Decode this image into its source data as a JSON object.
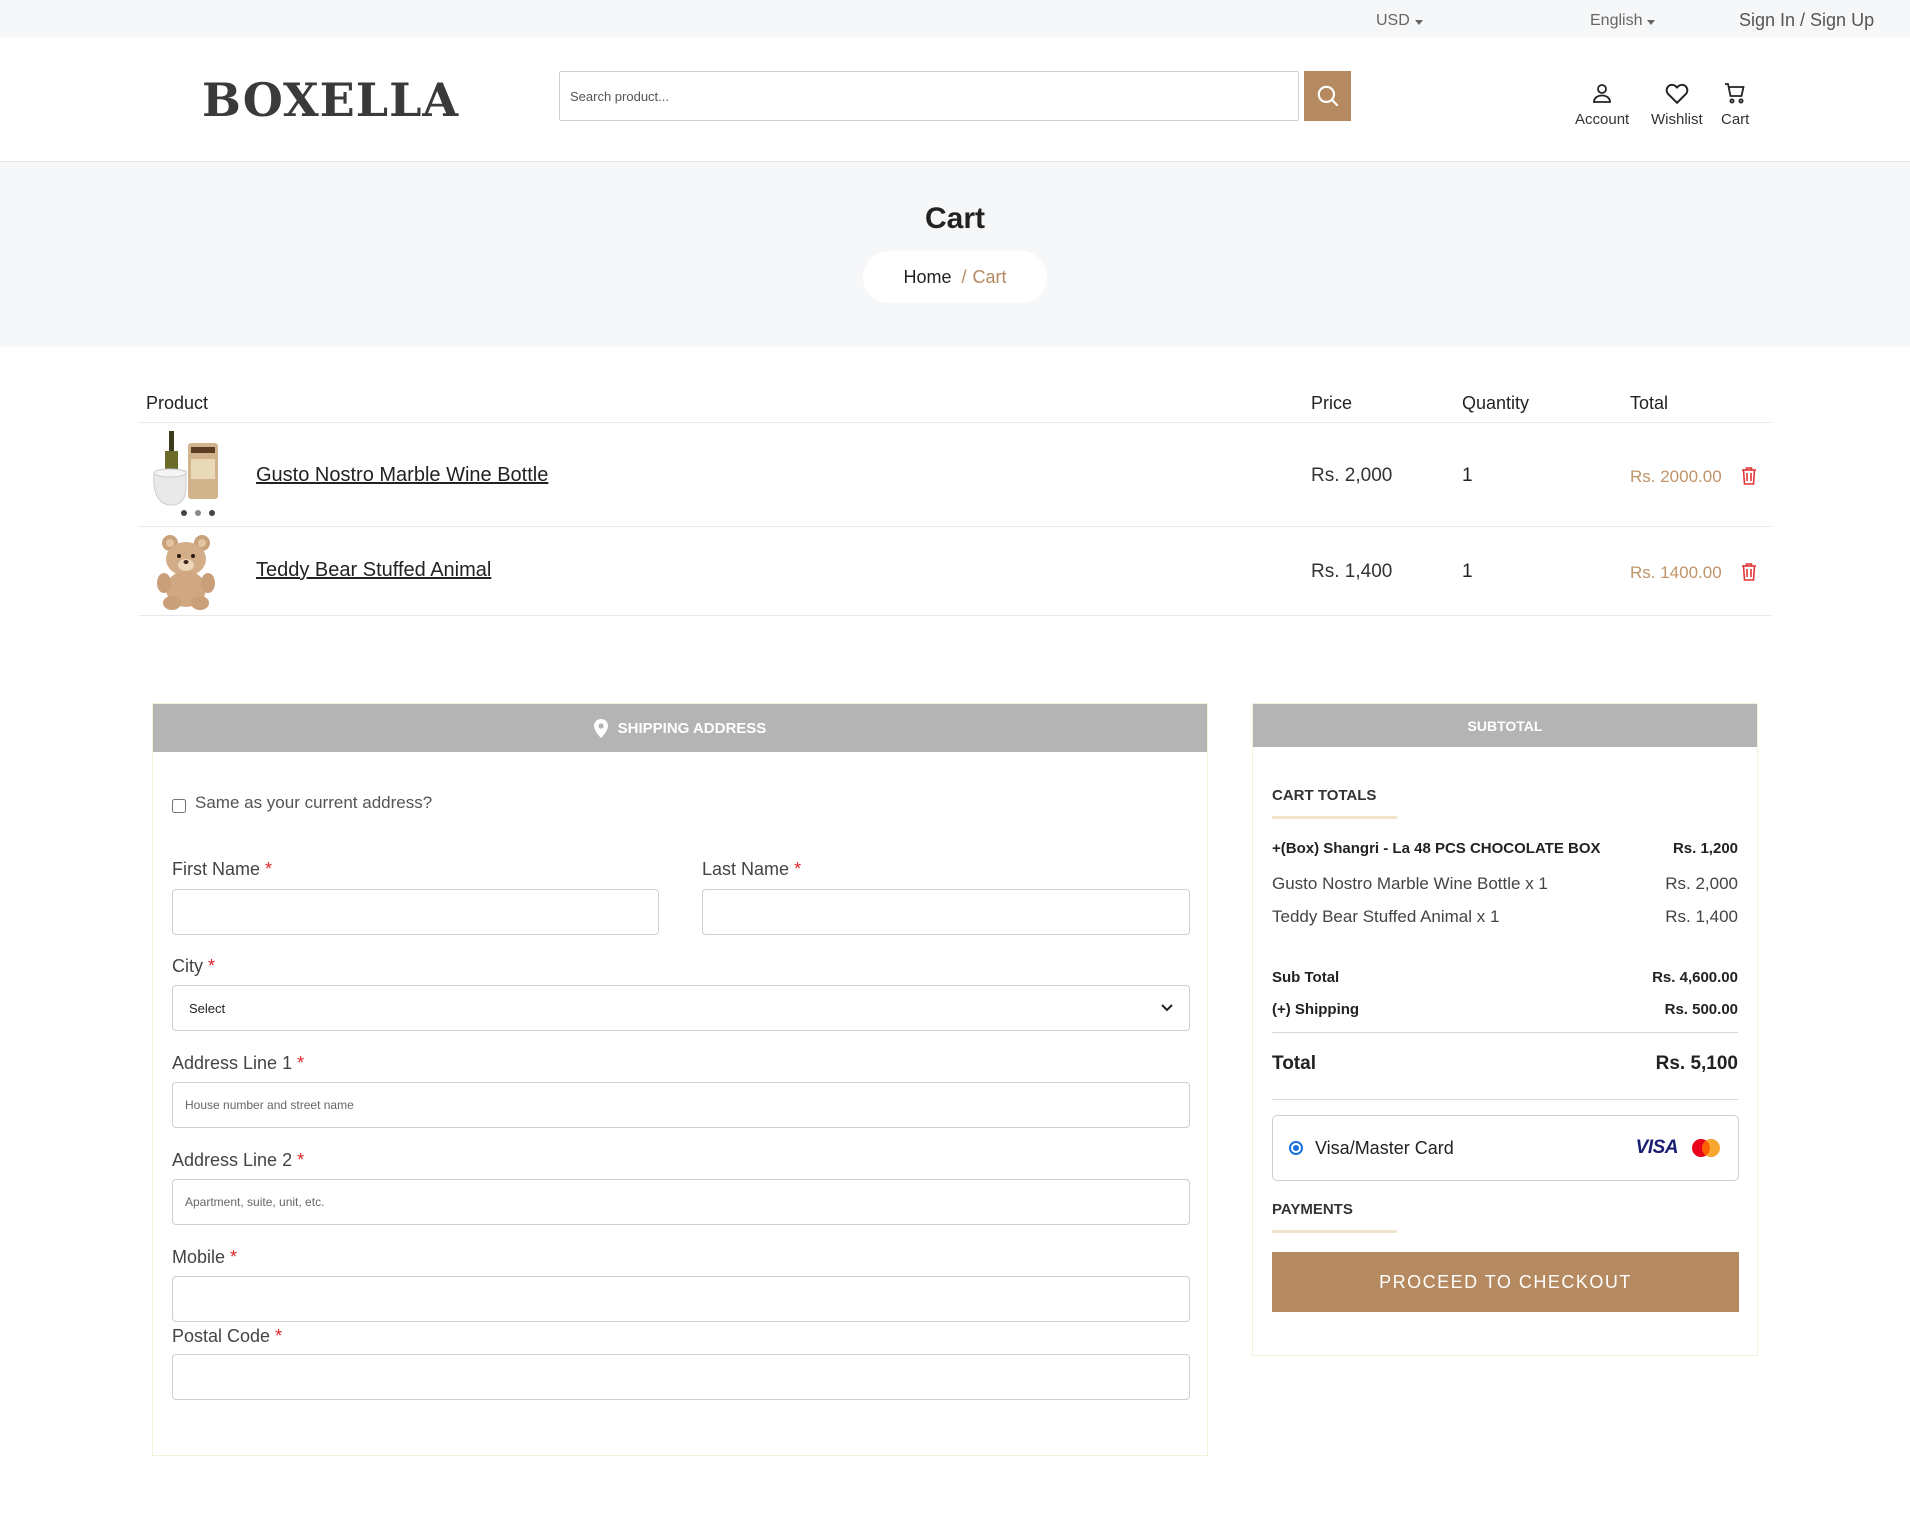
{
  "topbar": {
    "currency": "USD",
    "language": "English",
    "auth": "Sign In / Sign Up"
  },
  "header": {
    "logo": "BOXELLA",
    "search_placeholder": "Search product...",
    "actions": {
      "account": "Account",
      "wishlist": "Wishlist",
      "cart": "Cart"
    }
  },
  "hero": {
    "title": "Cart",
    "breadcrumb": {
      "home": "Home",
      "separator": "/",
      "current": "Cart"
    }
  },
  "cart_table": {
    "columns": {
      "product": "Product",
      "price": "Price",
      "quantity": "Quantity",
      "total": "Total"
    },
    "rows": [
      {
        "name": "Gusto Nostro Marble Wine Bottle",
        "price": "Rs. 2,000",
        "quantity": "1",
        "total": "Rs. 2000.00",
        "image": "wine-bottle-chiller-image"
      },
      {
        "name": "Teddy Bear Stuffed Animal",
        "price": "Rs. 1,400",
        "quantity": "1",
        "total": "Rs. 1400.00",
        "image": "teddy-bear-image"
      }
    ]
  },
  "shipping": {
    "header": "SHIPPING ADDRESS",
    "same_address_label": "Same as your current address?",
    "fields": {
      "first_name": {
        "label": "First Name",
        "value": ""
      },
      "last_name": {
        "label": "Last Name",
        "value": ""
      },
      "city": {
        "label": "City",
        "selected": "Select"
      },
      "address1": {
        "label": "Address Line 1",
        "placeholder": "House number and street name"
      },
      "address2": {
        "label": "Address Line 2",
        "placeholder": "Apartment, suite, unit, etc."
      },
      "mobile": {
        "label": "Mobile",
        "value": ""
      },
      "postal": {
        "label": "Postal Code",
        "value": ""
      }
    },
    "required_mark": "*"
  },
  "subtotal": {
    "header": "SUBTOTAL",
    "cart_totals_title": "CART TOTALS",
    "box_item": {
      "label": "+(Box) Shangri - La 48 PCS CHOCOLATE BOX",
      "amount": "Rs. 1,200"
    },
    "items": [
      {
        "label": "Gusto Nostro Marble Wine Bottle x 1",
        "amount": "Rs. 2,000"
      },
      {
        "label": "Teddy Bear Stuffed Animal x 1",
        "amount": "Rs. 1,400"
      }
    ],
    "sub_total": {
      "label": "Sub Total",
      "amount": "Rs. 4,600.00"
    },
    "shipping": {
      "label": "(+) Shipping",
      "amount": "Rs. 500.00"
    },
    "total": {
      "label": "Total",
      "amount": "Rs. 5,100"
    },
    "payment_option": {
      "label": "Visa/Master Card",
      "brand_visa": "VISA"
    },
    "payments_title": "PAYMENTS",
    "checkout_button": "PROCEED TO CHECKOUT"
  },
  "colors": {
    "accent": "#b58a60",
    "price_total": "#c09468",
    "panel_header": "#b4b4b4",
    "delete_icon": "#e0343a",
    "required": "#e0242a"
  }
}
